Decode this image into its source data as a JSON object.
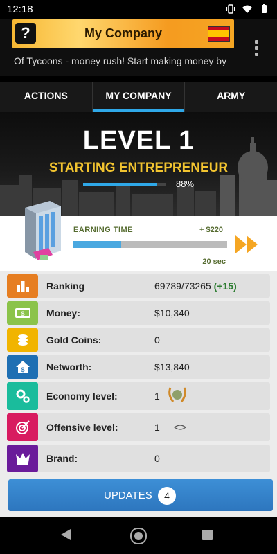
{
  "status": {
    "time": "12:18"
  },
  "appbar": {
    "help_label": "?",
    "company_title": "My Company",
    "ticker": "Of Tycoons - money rush! Start making money by"
  },
  "tabs": [
    {
      "label": "ACTIONS"
    },
    {
      "label": "MY COMPANY",
      "active": true
    },
    {
      "label": "ARMY"
    }
  ],
  "hero": {
    "level": "LEVEL 1",
    "rank_title": "STARTING ENTREPRENEUR",
    "progress_percent": 88,
    "progress_label": "88%"
  },
  "earning": {
    "label": "EARNING TIME",
    "reward": "+ $220",
    "time_left": "20 sec",
    "progress_fraction": 0.31
  },
  "stats": [
    {
      "icon": "bar-chart-icon",
      "label": "Ranking",
      "value": "69789/73265",
      "delta": "(+15)",
      "color": "#e67e22"
    },
    {
      "icon": "cash-icon",
      "label": "Money:",
      "value": "$10,340",
      "color": "#8bc34a"
    },
    {
      "icon": "coins-icon",
      "label": "Gold Coins:",
      "value": "0",
      "color": "#f1b400"
    },
    {
      "icon": "house-dollar-icon",
      "label": "Networth:",
      "value": "$13,840",
      "color": "#1e6fb3"
    },
    {
      "icon": "gears-icon",
      "label": "Economy level:",
      "value": "1",
      "color": "#1abc9c"
    },
    {
      "icon": "target-icon",
      "label": "Offensive level:",
      "value": "1",
      "color": "#d81b60"
    },
    {
      "icon": "crown-icon",
      "label": "Brand:",
      "value": "0",
      "color": "#6a1b9a"
    }
  ],
  "updates": {
    "label": "UPDATES",
    "count": "4"
  }
}
